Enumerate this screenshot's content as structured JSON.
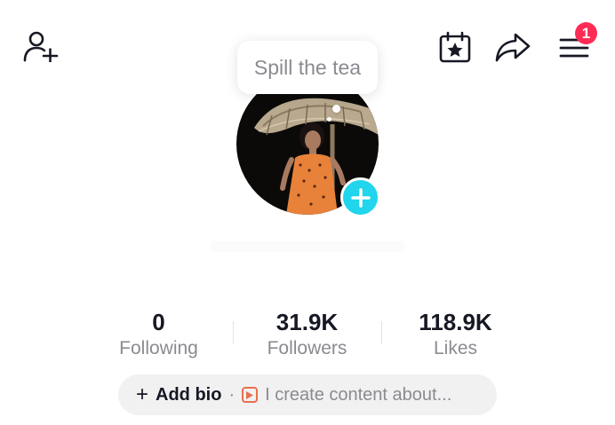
{
  "header": {
    "add_friend_icon": "person-add-icon",
    "calendar_icon": "calendar-star-icon",
    "share_icon": "share-arrow-icon",
    "menu_icon": "hamburger-menu-icon",
    "menu_badge": "1",
    "badge_color": "#fe2c55"
  },
  "profile": {
    "bubble_text": "Spill the tea",
    "avatar_add_icon": "plus-icon",
    "avatar_add_color": "#20d5ec"
  },
  "stats": [
    {
      "value": "0",
      "label": "Following"
    },
    {
      "value": "31.9K",
      "label": "Followers"
    },
    {
      "value": "118.9K",
      "label": "Likes"
    }
  ],
  "bio": {
    "add_label": "Add bio",
    "separator": "·",
    "hint_icon": "video-play-icon",
    "hint_text": "I create content about..."
  }
}
